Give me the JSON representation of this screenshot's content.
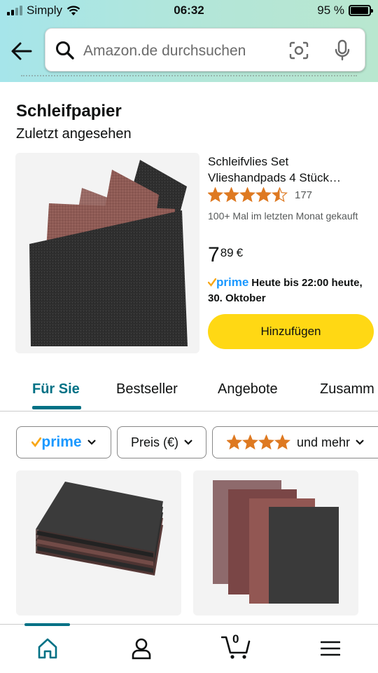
{
  "status_bar": {
    "carrier": "Simply",
    "time": "06:32",
    "battery": "95 %",
    "battery_level": 0.95
  },
  "search": {
    "placeholder": "Amazon.de durchsuchen"
  },
  "section": {
    "title": "Schleifpapier",
    "subtitle": "Zuletzt angesehen"
  },
  "product": {
    "title": "Schleifvlies Set Vlieshandpads 4 Stück…",
    "rating": 4.5,
    "rating_count": "177",
    "bought": "100+ Mal im letzten Monat gekauft",
    "price_whole": "7",
    "price_fraction": "89",
    "currency": "€",
    "prime_label": "prime",
    "delivery": "Heute bis 22:00 heute, 30. Oktober",
    "add_button": "Hinzufügen"
  },
  "tabs": [
    {
      "label": "Für Sie",
      "active": true
    },
    {
      "label": "Bestseller"
    },
    {
      "label": "Angebote"
    },
    {
      "label": "Zusamm"
    }
  ],
  "filters": {
    "prime": "prime",
    "price": "Preis (€)",
    "rating_stars": 4,
    "rating_suffix": "und mehr"
  },
  "bottom_nav": {
    "cart_count": "0",
    "items": [
      "home-icon",
      "account-icon",
      "cart-icon",
      "menu-icon"
    ]
  },
  "colors": {
    "accent": "#007185",
    "button": "#ffd814",
    "star": "#de7921",
    "prime": "#1a98ff"
  }
}
